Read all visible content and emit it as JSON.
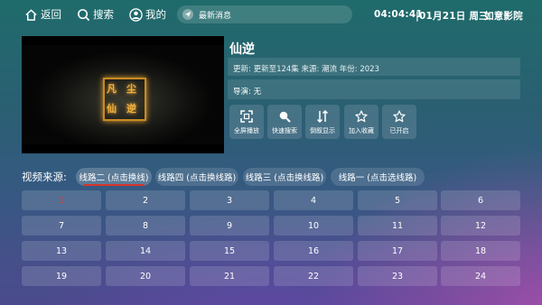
{
  "topbar": {
    "back_label": "返回",
    "search_label": "搜索",
    "mine_label": "我的",
    "message_label": "最新消息",
    "time": "04:04:41",
    "date": "|01月21日 周三",
    "app_name": "如意影院"
  },
  "detail": {
    "title": "仙逆",
    "meta": "更新: 更新至124集  来源: 潮流  年份: 2023",
    "actors": "导演: 无",
    "actions": [
      {
        "label": "全屏播放",
        "icon": "fullscreen-icon"
      },
      {
        "label": "快速搜索",
        "icon": "search-icon"
      },
      {
        "label": "倒叙显示",
        "icon": "sort-icon"
      },
      {
        "label": "加入收藏",
        "icon": "star-icon"
      },
      {
        "label": "已开启",
        "icon": "star-icon"
      }
    ]
  },
  "sources": {
    "label": "视频来源:",
    "items": [
      "线路二 (点击换线)",
      "线路四 (点击换线路)",
      "线路三 (点击换线路)",
      "线路一 (点击选线路)"
    ],
    "active_index": 0
  },
  "episodes": {
    "items": [
      "1",
      "2",
      "3",
      "4",
      "5",
      "6",
      "7",
      "8",
      "9",
      "10",
      "11",
      "12",
      "13",
      "14",
      "15",
      "16",
      "17",
      "18",
      "19",
      "20",
      "21",
      "22",
      "23",
      "24"
    ],
    "current_index": 0
  },
  "colors": {
    "current_episode": "#e0362c",
    "active_underline": "#d8342c",
    "logo_gold": "#f0b040"
  }
}
